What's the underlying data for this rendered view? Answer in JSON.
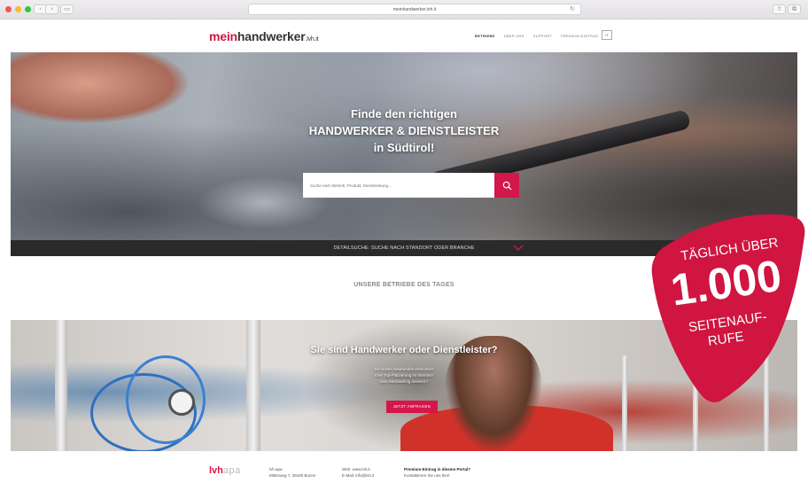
{
  "browser": {
    "address": "meinhandwerker.lvh.it"
  },
  "header": {
    "logo_mein": "mein",
    "logo_handwerker": "handwerker",
    "logo_tld": ".lvh.it",
    "nav": [
      "BETRIEBE",
      "ÜBER UNS",
      "SUPPORT",
      "PREMIUM-EINTRAG"
    ],
    "lang": "IT"
  },
  "hero": {
    "line1": "Finde den richtigen",
    "line2": "HANDWERKER & DIENSTLEISTER",
    "line3": "in Südtirol!",
    "search_placeholder": "Suche nach Betrieb, Produkt, Dienstleistung..."
  },
  "detail_search": {
    "label": "DETAILSUCHE: SUCHE NACH STANDORT ODER BRANCHE"
  },
  "daily": {
    "title": "UNSERE BETRIEBE DES TAGES"
  },
  "cta": {
    "title": "Sie sind Handwerker oder Dienstleister?",
    "lines": [
      "Sie wollen Neukunden erreichen?",
      "Eine Top-Platzierung im Internet?",
      "Den Werbeerfolg messen?"
    ],
    "button": "JETZT ANFRAGEN"
  },
  "footer": {
    "logo_a": "lvh",
    "logo_b": "apa",
    "col1": [
      "lvh.apa",
      "Mitterweg 7, 39100 Bozen"
    ],
    "col2": [
      "Web: www.lvh.it",
      "E-Mail: info@lvh.it"
    ],
    "col3_bold": "Premium-Eintrag in diesem Portal?",
    "col3_text": "Kontaktieren Sie uns hier!"
  },
  "badge": {
    "line1": "TÄGLICH ÜBER",
    "number": "1.000",
    "line2": "SEITENAUF-",
    "line3": "RUFE",
    "color": "#cf1540"
  },
  "colors": {
    "accent": "#d4174a",
    "dark_bar": "#2a2a2b"
  }
}
